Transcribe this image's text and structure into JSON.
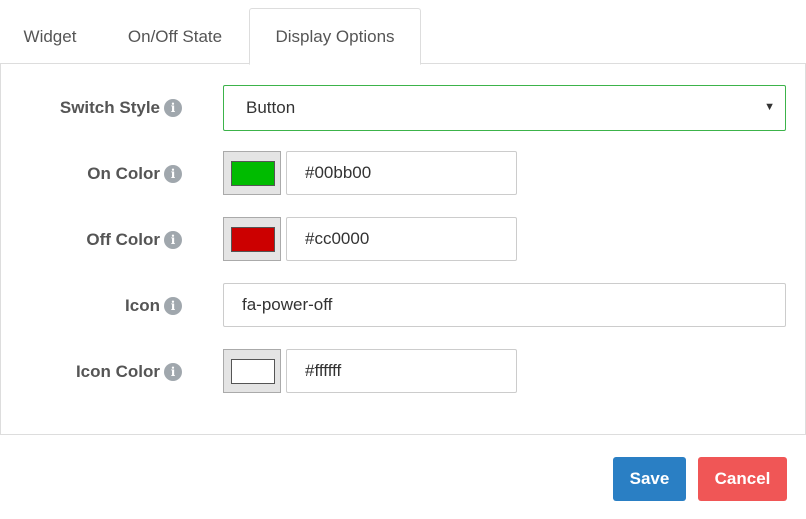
{
  "tabs": [
    {
      "label": "Widget",
      "active": false
    },
    {
      "label": "On/Off State",
      "active": false
    },
    {
      "label": "Display Options",
      "active": true
    }
  ],
  "form": {
    "switch_style": {
      "label": "Switch Style",
      "value": "Button",
      "icon": "info-circle-icon"
    },
    "on_color": {
      "label": "On Color",
      "value": "#00bb00",
      "swatch": "#00bb00",
      "icon": "info-circle-icon"
    },
    "off_color": {
      "label": "Off Color",
      "value": "#cc0000",
      "swatch": "#cc0000",
      "icon": "info-circle-icon"
    },
    "icon": {
      "label": "Icon",
      "value": "fa-power-off",
      "icon": "info-circle-icon"
    },
    "icon_color": {
      "label": "Icon Color",
      "value": "#ffffff",
      "swatch": "#ffffff",
      "icon": "info-circle-icon"
    }
  },
  "buttons": {
    "save": {
      "label": "Save",
      "color": "#2a7fc4"
    },
    "cancel": {
      "label": "Cancel",
      "color": "#f05656"
    }
  },
  "colors": {
    "select_border": "#3cb34a"
  }
}
